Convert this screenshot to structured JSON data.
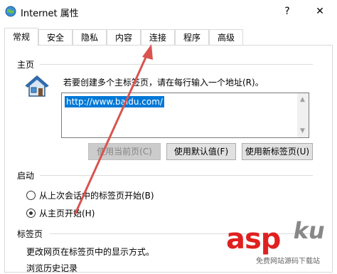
{
  "window": {
    "title": "Internet 属性",
    "help_label": "?",
    "close_label": "✕",
    "app_icon": "globe-icon"
  },
  "tabs": [
    {
      "label": "常规",
      "active": true
    },
    {
      "label": "安全",
      "active": false
    },
    {
      "label": "隐私",
      "active": false
    },
    {
      "label": "内容",
      "active": false
    },
    {
      "label": "连接",
      "active": false
    },
    {
      "label": "程序",
      "active": false
    },
    {
      "label": "高级",
      "active": false
    }
  ],
  "home": {
    "section_label": "主页",
    "icon": "house-icon",
    "hint": "若要创建多个主标签页，请在每行输入一个地址(R)。",
    "url_value": "http://www.baidu.com/",
    "buttons": {
      "use_current": "使用当前页(C)",
      "use_default": "使用默认值(F)",
      "use_new_tab": "使用新标签页(U)"
    }
  },
  "startup": {
    "section_label": "启动",
    "options": [
      {
        "label": "从上次会话中的标签页开始(B)",
        "selected": false
      },
      {
        "label": "从主页开始(H)",
        "selected": true
      }
    ]
  },
  "tabs_section": {
    "section_label": "标签页",
    "description": "更改网页在标签页中的显示方式。",
    "cut_text": "浏览历史记录"
  },
  "watermark": {
    "brand_main": "asp",
    "brand_suffix": "ku",
    "tagline": "免费网站源码下载站"
  },
  "colors": {
    "selection": "#0078d7",
    "annotation_arrow": "#d9534f",
    "watermark_red": "#e02020"
  }
}
